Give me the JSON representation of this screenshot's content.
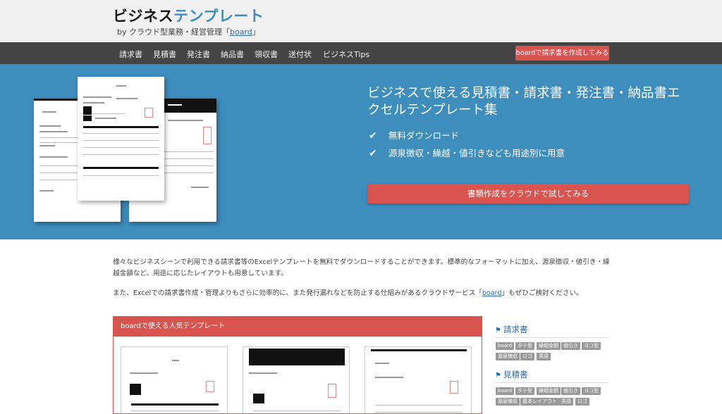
{
  "header": {
    "title_part1": "ビジネス",
    "title_part2": "テンプレート",
    "subtitle_prefix": "by クラウド型業務・経営管理「",
    "subtitle_link": "board",
    "subtitle_suffix": "」"
  },
  "nav": {
    "items": [
      "請求書",
      "見積書",
      "発注書",
      "納品書",
      "領収書",
      "送付状",
      "ビジネスTips"
    ],
    "cta": "boardで請求書を作成してみる"
  },
  "hero": {
    "title": "ビジネスで使える見積書・請求書・発注書・納品書エクセルテンプレート集",
    "features": [
      "無料ダウンロード",
      "源泉徴収・繰越・値引きなども用途別に用意"
    ],
    "cta": "書類作成をクラウドで試してみる",
    "check_icon": "check-icon"
  },
  "intro": {
    "paragraph1": "様々なビジネスシーンで利用できる請求書等のExcelテンプレートを無料でダウンロードすることができます。標準的なフォーマットに加え、源泉徴収・値引き・繰越金額など、用途に応じたレイアウトも用意しています。",
    "paragraph2_prefix": "また、Excelでの請求書作成・管理よりもさらに効率的に、また発行漏れなどを防止する仕組みがあるクラウドサービス「",
    "paragraph2_link": "board",
    "paragraph2_suffix": "」もぜひご検討ください。"
  },
  "popular": {
    "heading": "boardで使える人気テンプレート"
  },
  "sidebar": {
    "sections": [
      {
        "heading": "請求書",
        "tags": [
          "board",
          "タテ型",
          "繰越金額",
          "値引き",
          "ヨコ型",
          "源泉徴収",
          "ロゴ",
          "英語"
        ]
      },
      {
        "heading": "見積書",
        "tags": [
          "board",
          "タテ型",
          "繰越金額",
          "値引き",
          "ヨコ型",
          "源泉徴収",
          "基本レイアウト",
          "英語",
          "ロゴ"
        ]
      }
    ]
  },
  "colors": {
    "accent_red": "#d9534f",
    "hero_blue": "#3d8dbd",
    "nav_bg": "#444444",
    "link_blue": "#2e6da4"
  }
}
